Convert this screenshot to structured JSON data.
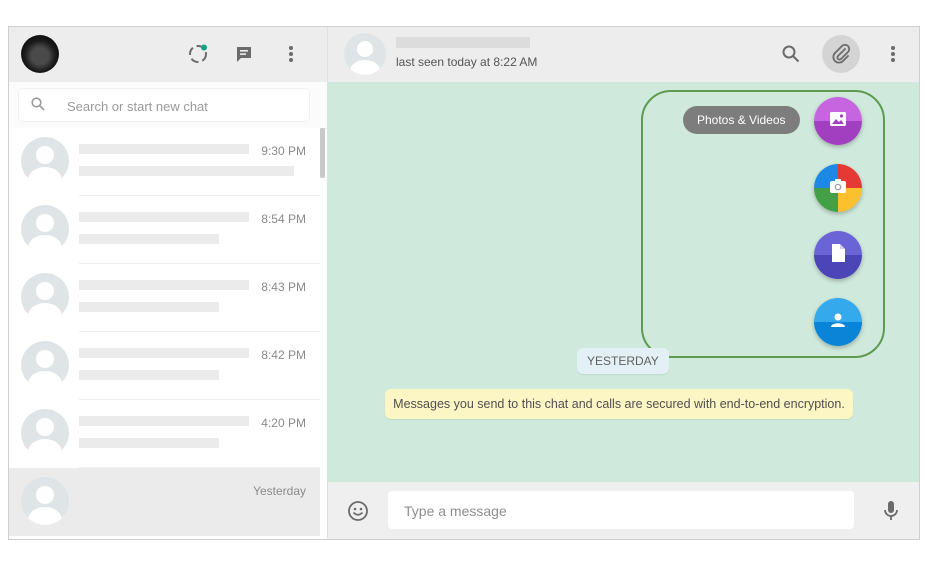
{
  "search": {
    "placeholder": "Search or start new chat"
  },
  "chats": [
    {
      "time": "9:30 PM"
    },
    {
      "time": "8:54 PM"
    },
    {
      "time": "8:43 PM"
    },
    {
      "time": "8:42 PM"
    },
    {
      "time": "4:20 PM"
    },
    {
      "time": "Yesterday",
      "active": true
    }
  ],
  "conversation": {
    "last_seen": "last seen today at 8:22 AM",
    "date_chip": "YESTERDAY",
    "encryption_notice": "Messages you send to this chat and calls are secured with end-to-end encryption."
  },
  "attach_menu": {
    "tooltip": "Photos & Videos",
    "items": [
      "photos-videos",
      "camera",
      "document",
      "contact"
    ]
  },
  "composer": {
    "placeholder": "Type a message"
  },
  "icons": {
    "left_header": [
      "status-icon",
      "new-chat-icon",
      "menu-icon"
    ],
    "right_header": [
      "search-icon",
      "attach-icon",
      "menu-icon"
    ]
  },
  "colors": {
    "conversation_bg": "#cfe9dc",
    "header_bg": "#ededed",
    "highlight_border": "#5d9b4f",
    "notice_bg": "#fcf5c4"
  }
}
